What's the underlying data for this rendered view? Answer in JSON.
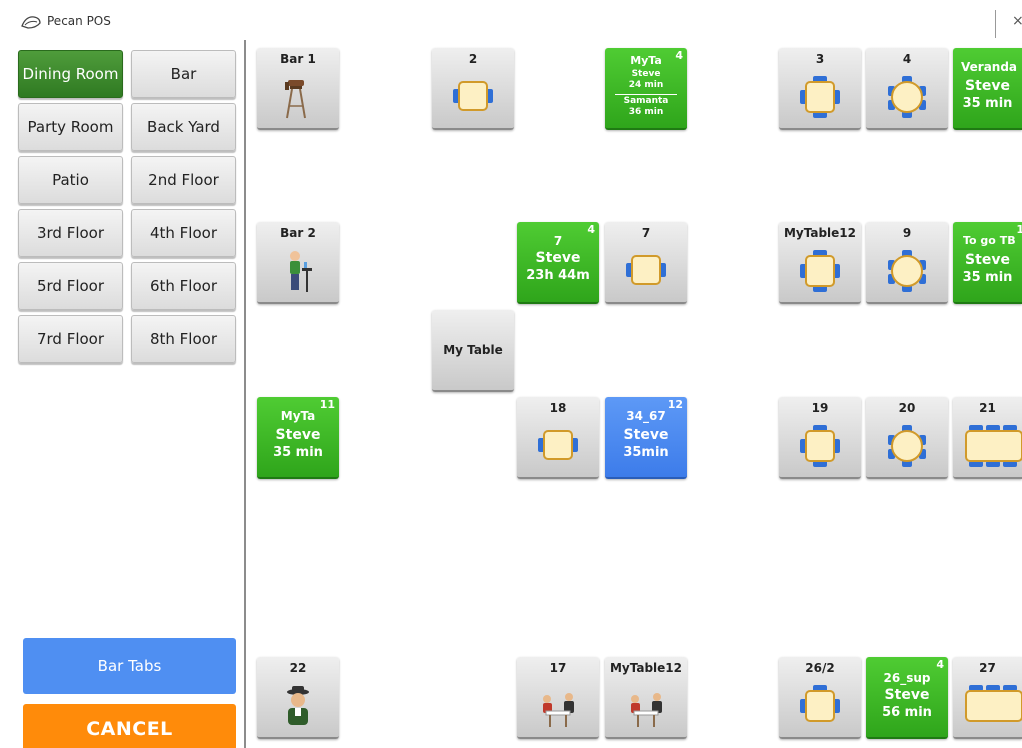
{
  "app": {
    "title": "Pecan POS",
    "close_glyph": "×"
  },
  "rooms": [
    {
      "label": "Dining Room",
      "active": true
    },
    {
      "label": "Bar",
      "active": false
    },
    {
      "label": "Party Room",
      "active": false
    },
    {
      "label": "Back Yard",
      "active": false
    },
    {
      "label": "Patio",
      "active": false
    },
    {
      "label": "2nd Floor",
      "active": false
    },
    {
      "label": "3rd Floor",
      "active": false
    },
    {
      "label": "4th Floor",
      "active": false
    },
    {
      "label": "5rd Floor",
      "active": false
    },
    {
      "label": "6th Floor",
      "active": false
    },
    {
      "label": "7rd Floor",
      "active": false
    },
    {
      "label": "8th Floor",
      "active": false
    }
  ],
  "actions": {
    "bar_tabs": "Bar Tabs",
    "cancel": "CANCEL"
  },
  "tables": {
    "bar1": {
      "label": "Bar 1",
      "icon": "bar-stool-icon"
    },
    "t2": {
      "label": "2",
      "icon": "square-table-icon"
    },
    "myta_top": {
      "label": "MyTa",
      "seats": "4",
      "server1": "Steve",
      "time1": "24 min",
      "server2": "Samanta",
      "time2": "36 min"
    },
    "t3": {
      "label": "3",
      "icon": "square-table-icon"
    },
    "t4": {
      "label": "4",
      "icon": "round-table-icon"
    },
    "veranda": {
      "label": "Veranda",
      "server": "Steve",
      "time": "35 min"
    },
    "bar2": {
      "label": "Bar 2",
      "icon": "bar-person-icon"
    },
    "t7_green": {
      "label": "7",
      "seats": "4",
      "server": "Steve",
      "time": "23h 44m"
    },
    "t7": {
      "label": "7",
      "icon": "square-table-icon"
    },
    "mytable12_a": {
      "label": "MyTable12",
      "icon": "square-table-icon"
    },
    "t9": {
      "label": "9",
      "icon": "round-table-icon"
    },
    "togo": {
      "label": "To go TB",
      "seats": "1",
      "server": "Steve",
      "time": "35 min"
    },
    "mytable": {
      "label": "My Table"
    },
    "myta_11": {
      "label": "MyTa",
      "seats": "11",
      "server": "Steve",
      "time": "35 min"
    },
    "t18": {
      "label": "18",
      "icon": "square-table-icon"
    },
    "t34_67": {
      "label": "34_67",
      "seats": "12",
      "server": "Steve",
      "time": "35min"
    },
    "t19": {
      "label": "19",
      "icon": "square-table-icon"
    },
    "t20": {
      "label": "20",
      "icon": "round-table-icon"
    },
    "t21": {
      "label": "21",
      "icon": "long-table-icon"
    },
    "t22": {
      "label": "22",
      "icon": "waiter-icon"
    },
    "t17": {
      "label": "17",
      "icon": "diners-icon"
    },
    "mytable12_b": {
      "label": "MyTable12",
      "icon": "diners-icon"
    },
    "t26_2": {
      "label": "26/2",
      "icon": "square-table-icon"
    },
    "t26_sup": {
      "label": "26_sup",
      "seats": "4",
      "server": "Steve",
      "time": "56 min"
    },
    "t27": {
      "label": "27",
      "icon": "long-table-icon"
    }
  },
  "colors": {
    "occupied": "#3fb82a",
    "selected": "#4a86ee",
    "active_room": "#3e8a2e",
    "bar_tabs": "#4f8ff2",
    "cancel": "#ff8b0a",
    "chair": "#2f6fd6",
    "tabletop": "#fdf0c4"
  }
}
